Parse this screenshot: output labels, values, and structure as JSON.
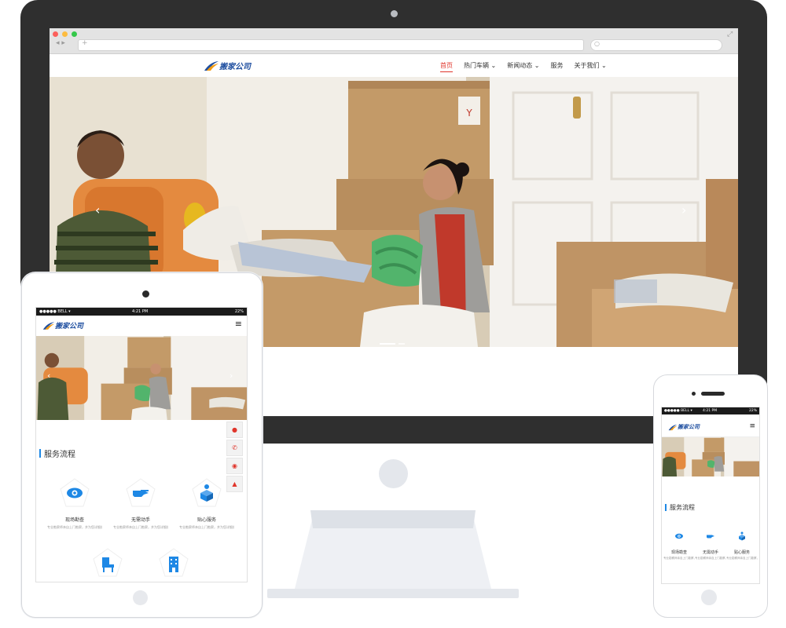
{
  "desktop": {
    "logo_text": "搬家公司",
    "menu": [
      {
        "label": "首页",
        "active": true
      },
      {
        "label": "热门车辆 ⌄",
        "active": false
      },
      {
        "label": "新闻动态 ⌄",
        "active": false
      },
      {
        "label": "服务",
        "active": false
      },
      {
        "label": "关于我们 ⌄",
        "active": false
      }
    ],
    "slider_prev": "‹",
    "slider_next": "›"
  },
  "tablet": {
    "status": {
      "carrier": "●●●●● BELL ▾",
      "time": "4:21 PM",
      "battery": "22%"
    },
    "logo_text": "搬家公司",
    "menu_icon": "≡",
    "section_title": "服务流程",
    "steps": [
      {
        "icon": "eye-icon",
        "label": "现场勘查",
        "desc": "专业勘察师亲自上门勘察，并为您详细规划"
      },
      {
        "icon": "hand-icon",
        "label": "无需动手",
        "desc": "专业勘察师亲自上门勘察，并为您详细规划"
      },
      {
        "icon": "box-icon",
        "label": "贴心服务",
        "desc": "专业勘察师亲自上门勘察，并为您详细规划"
      },
      {
        "icon": "chair-icon",
        "label": "",
        "desc": ""
      },
      {
        "icon": "building-icon",
        "label": "",
        "desc": ""
      }
    ],
    "side_buttons": [
      "bell-icon",
      "phone-icon",
      "wechat-icon",
      "up-arrow-icon"
    ],
    "slider_prev": "‹",
    "slider_next": "›"
  },
  "phone": {
    "status": {
      "carrier": "●●●●● BELL ▾",
      "time": "4:21 PM",
      "battery": "22%"
    },
    "logo_text": "搬家公司",
    "menu_icon": "≡",
    "section_title": "服务流程",
    "steps": [
      {
        "icon": "eye-icon",
        "label": "现场勘查",
        "desc": "专业勘察师亲自上门勘察，并为您详细规划"
      },
      {
        "icon": "hand-icon",
        "label": "无需动手",
        "desc": "专业勘察师亲自上门勘察，并为您详细规划"
      },
      {
        "icon": "box-icon",
        "label": "贴心服务",
        "desc": "专业勘察师亲自上门勘察，并为您详细规划"
      }
    ]
  },
  "colors": {
    "accent": "#1e88e5",
    "active_menu": "#e0352b",
    "bezel": "#2f2f2f"
  }
}
